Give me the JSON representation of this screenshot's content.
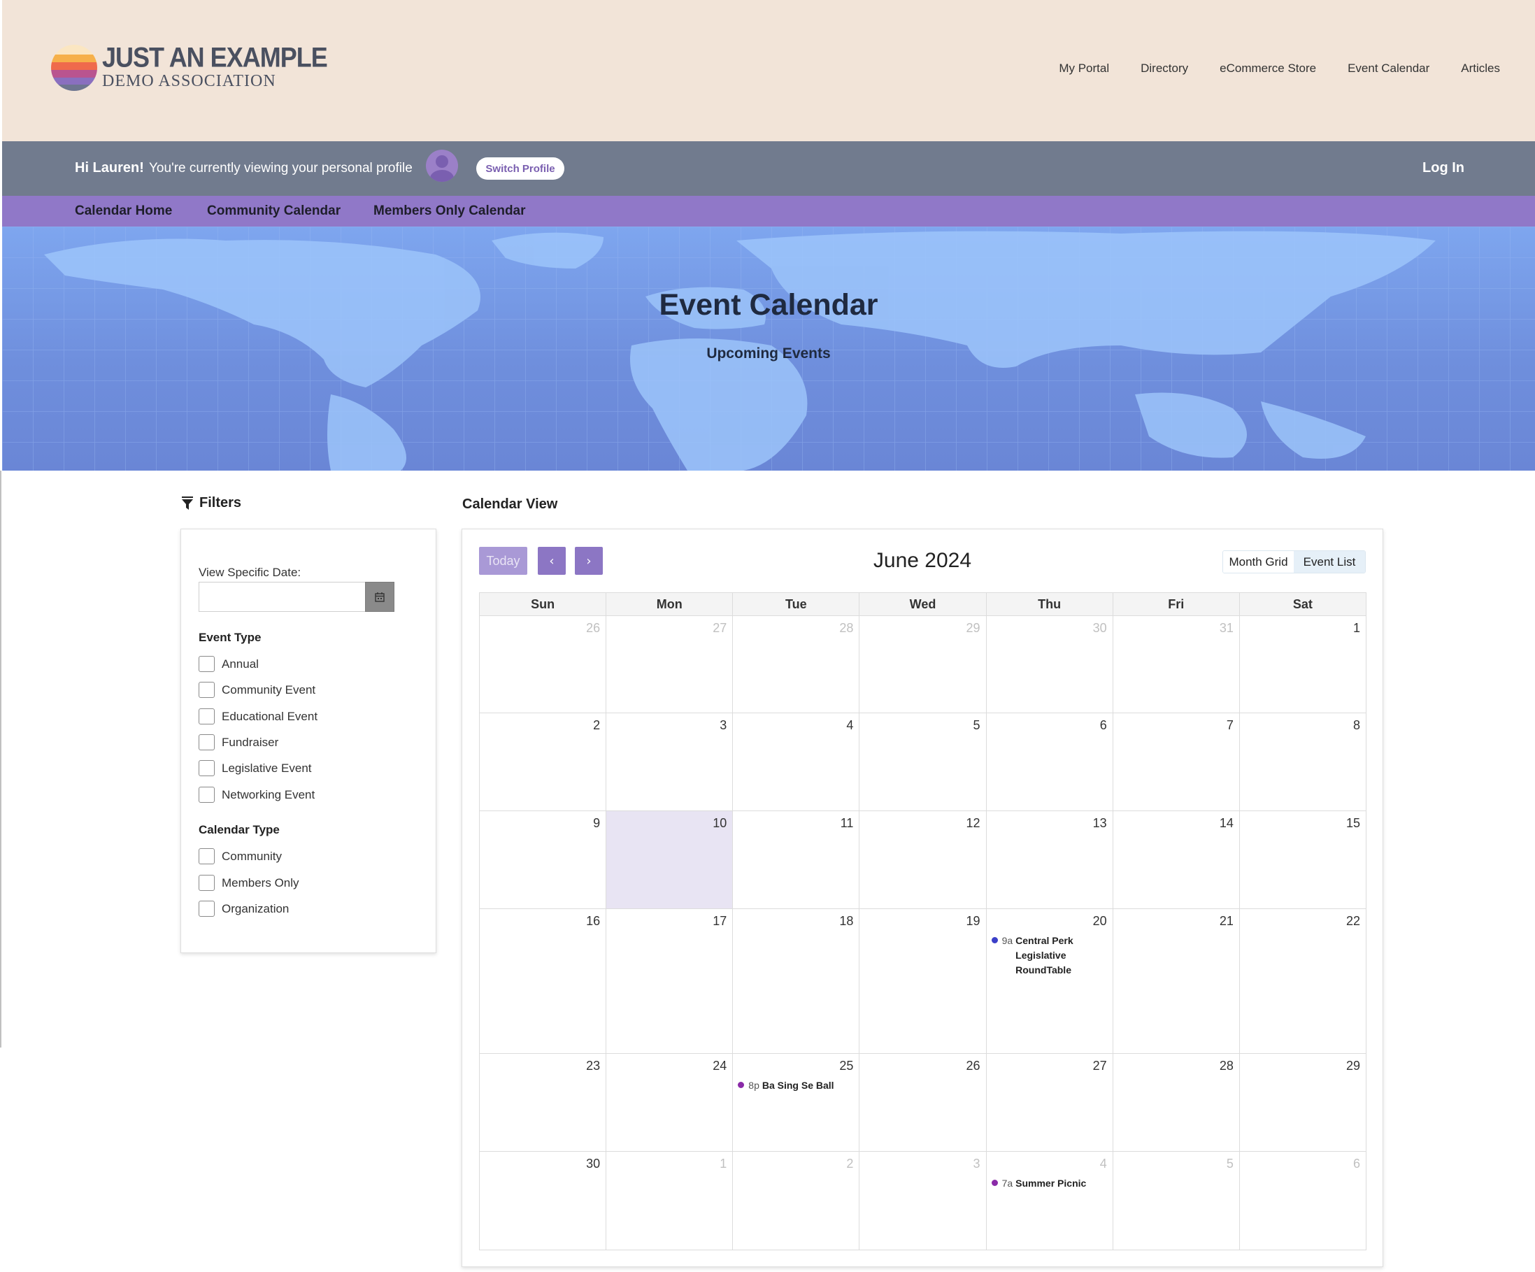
{
  "brand": {
    "line1": "JUST AN EXAMPLE",
    "line2": "DEMO ASSOCIATION"
  },
  "top_nav": [
    "My Portal",
    "Directory",
    "eCommerce Store",
    "Event Calendar",
    "Articles"
  ],
  "profile_bar": {
    "greeting": "Hi Lauren!",
    "viewing": "You're currently viewing your personal profile",
    "switch_label": "Switch Profile",
    "login_label": "Log In"
  },
  "calendar_nav": [
    "Calendar Home",
    "Community Calendar",
    "Members Only Calendar"
  ],
  "hero": {
    "title": "Event Calendar",
    "subtitle": "Upcoming Events"
  },
  "filters": {
    "heading": "Filters",
    "date_label": "View Specific Date:",
    "date_value": "",
    "event_type_title": "Event Type",
    "event_types": [
      "Annual",
      "Community Event",
      "Educational Event",
      "Fundraiser",
      "Legislative Event",
      "Networking Event"
    ],
    "calendar_type_title": "Calendar Type",
    "calendar_types": [
      "Community",
      "Members Only",
      "Organization"
    ]
  },
  "calendar": {
    "heading": "Calendar View",
    "today_label": "Today",
    "prev_label": "‹",
    "next_label": "›",
    "month_title": "June 2024",
    "view_month": "Month Grid",
    "view_list": "Event List",
    "weekdays": [
      "Sun",
      "Mon",
      "Tue",
      "Wed",
      "Thu",
      "Fri",
      "Sat"
    ],
    "weeks": [
      [
        {
          "d": "26",
          "o": true
        },
        {
          "d": "27",
          "o": true
        },
        {
          "d": "28",
          "o": true
        },
        {
          "d": "29",
          "o": true
        },
        {
          "d": "30",
          "o": true
        },
        {
          "d": "31",
          "o": true
        },
        {
          "d": "1"
        }
      ],
      [
        {
          "d": "2"
        },
        {
          "d": "3"
        },
        {
          "d": "4"
        },
        {
          "d": "5"
        },
        {
          "d": "6"
        },
        {
          "d": "7"
        },
        {
          "d": "8"
        }
      ],
      [
        {
          "d": "9"
        },
        {
          "d": "10",
          "today": true
        },
        {
          "d": "11"
        },
        {
          "d": "12"
        },
        {
          "d": "13"
        },
        {
          "d": "14"
        },
        {
          "d": "15"
        }
      ],
      [
        {
          "d": "16"
        },
        {
          "d": "17"
        },
        {
          "d": "18"
        },
        {
          "d": "19"
        },
        {
          "d": "20",
          "events": [
            {
              "time": "9a",
              "title": "Central Perk Legislative RoundTable",
              "color": "#3b3fc8"
            }
          ]
        },
        {
          "d": "21"
        },
        {
          "d": "22"
        }
      ],
      [
        {
          "d": "23"
        },
        {
          "d": "24"
        },
        {
          "d": "25",
          "events": [
            {
              "time": "8p",
              "title": "Ba Sing Se Ball",
              "color": "#8a2aa8"
            }
          ]
        },
        {
          "d": "26"
        },
        {
          "d": "27"
        },
        {
          "d": "28"
        },
        {
          "d": "29"
        }
      ],
      [
        {
          "d": "30"
        },
        {
          "d": "1",
          "o": true
        },
        {
          "d": "2",
          "o": true
        },
        {
          "d": "3",
          "o": true
        },
        {
          "d": "4",
          "o": true,
          "events": [
            {
              "time": "7a",
              "title": "Summer Picnic",
              "color": "#8a2aa8"
            }
          ]
        },
        {
          "d": "5",
          "o": true
        },
        {
          "d": "6",
          "o": true
        }
      ]
    ]
  },
  "colors": {
    "header_bg": "#f2e4d8",
    "profile_bar": "#717b8e",
    "cal_nav": "#9078c8",
    "accent": "#8c76c4"
  }
}
